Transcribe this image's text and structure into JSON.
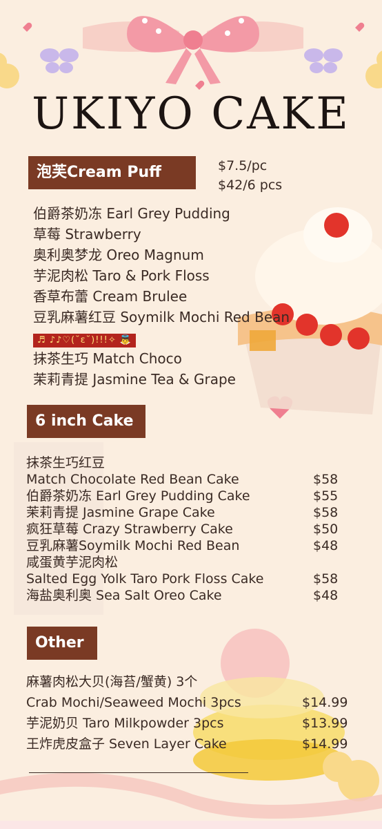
{
  "header": {
    "title": "UKIYO CAKE"
  },
  "cream_puff": {
    "tag": "泡芙Cream Puff",
    "price_single": "$7.5/pc",
    "price_six": "$42/6 pcs",
    "items": [
      "伯爵茶奶冻 Earl Grey Pudding",
      "草莓 Strawberry",
      "奥利奥梦龙 Oreo Magnum",
      "芋泥肉松 Taro & Pork Floss",
      "香草布蕾 Cream Brulee",
      "豆乳麻薯红豆 Soymilk Mochi Red Bean",
      "抹茶生巧 Match Choco",
      "茉莉青提 Jasmine Tea & Grape"
    ],
    "emoji_strip": "♬ ♪♪♡(˘ε˘)!!!✧ 👼"
  },
  "six_inch": {
    "tag": "6 inch Cake",
    "rows": [
      {
        "name": "抹茶生巧红豆",
        "price": ""
      },
      {
        "name": "Match Chocolate Red Bean Cake",
        "price": "$58"
      },
      {
        "name": "伯爵茶奶冻 Earl  Grey Pudding Cake",
        "price": "$55"
      },
      {
        "name": "茉莉青提 Jasmine Grape Cake",
        "price": "$58"
      },
      {
        "name": "疯狂草莓 Crazy Strawberry Cake",
        "price": "$50"
      },
      {
        "name": "豆乳麻薯Soymilk Mochi Red Bean",
        "price": "$48"
      },
      {
        "name": "咸蛋黄芋泥肉松",
        "price": ""
      },
      {
        "name": "Salted Egg Yolk Taro Pork Floss Cake",
        "price": "$58"
      },
      {
        "name": "海盐奥利奥 Sea Salt Oreo Cake",
        "price": "$48"
      }
    ]
  },
  "other": {
    "tag": "Other",
    "rows": [
      {
        "name": "麻薯肉松大贝(海苔/蟹黄) 3个",
        "price": ""
      },
      {
        "name": "Crab Mochi/Seaweed Mochi  3pcs",
        "price": "$14.99"
      },
      {
        "name": "芋泥奶贝 Taro Milkpowder 3pcs",
        "price": "$13.99"
      },
      {
        "name": "王炸虎皮盒子 Seven Layer Cake",
        "price": "$14.99"
      }
    ]
  },
  "colors": {
    "background": "#fbeee0",
    "tag": "#7a3a24",
    "text": "#3a2a24",
    "accent_pink": "#f29aa6"
  }
}
